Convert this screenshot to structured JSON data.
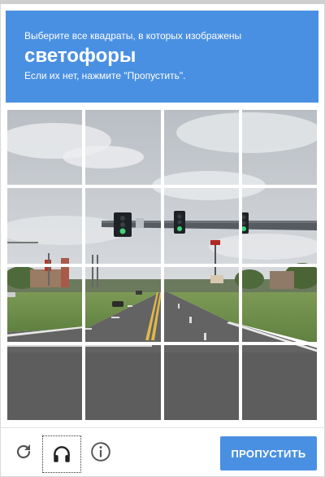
{
  "header": {
    "instruction": "Выберите все квадраты, в которых изображены",
    "keyword": "светофоры",
    "hint": "Если их нет, нажмите \"Пропустить\"."
  },
  "grid": {
    "rows": 4,
    "cols": 4
  },
  "footer": {
    "reload_icon": "reload-icon",
    "audio_icon": "headphones-icon",
    "info_icon": "info-icon",
    "skip_label": "ПРОПУСТИТЬ"
  },
  "colors": {
    "accent": "#4a90e2",
    "sky": "#c9cdd1",
    "grass": "#6f8f4a",
    "road": "#5d5d5d",
    "lane_yellow": "#e0b84a"
  }
}
